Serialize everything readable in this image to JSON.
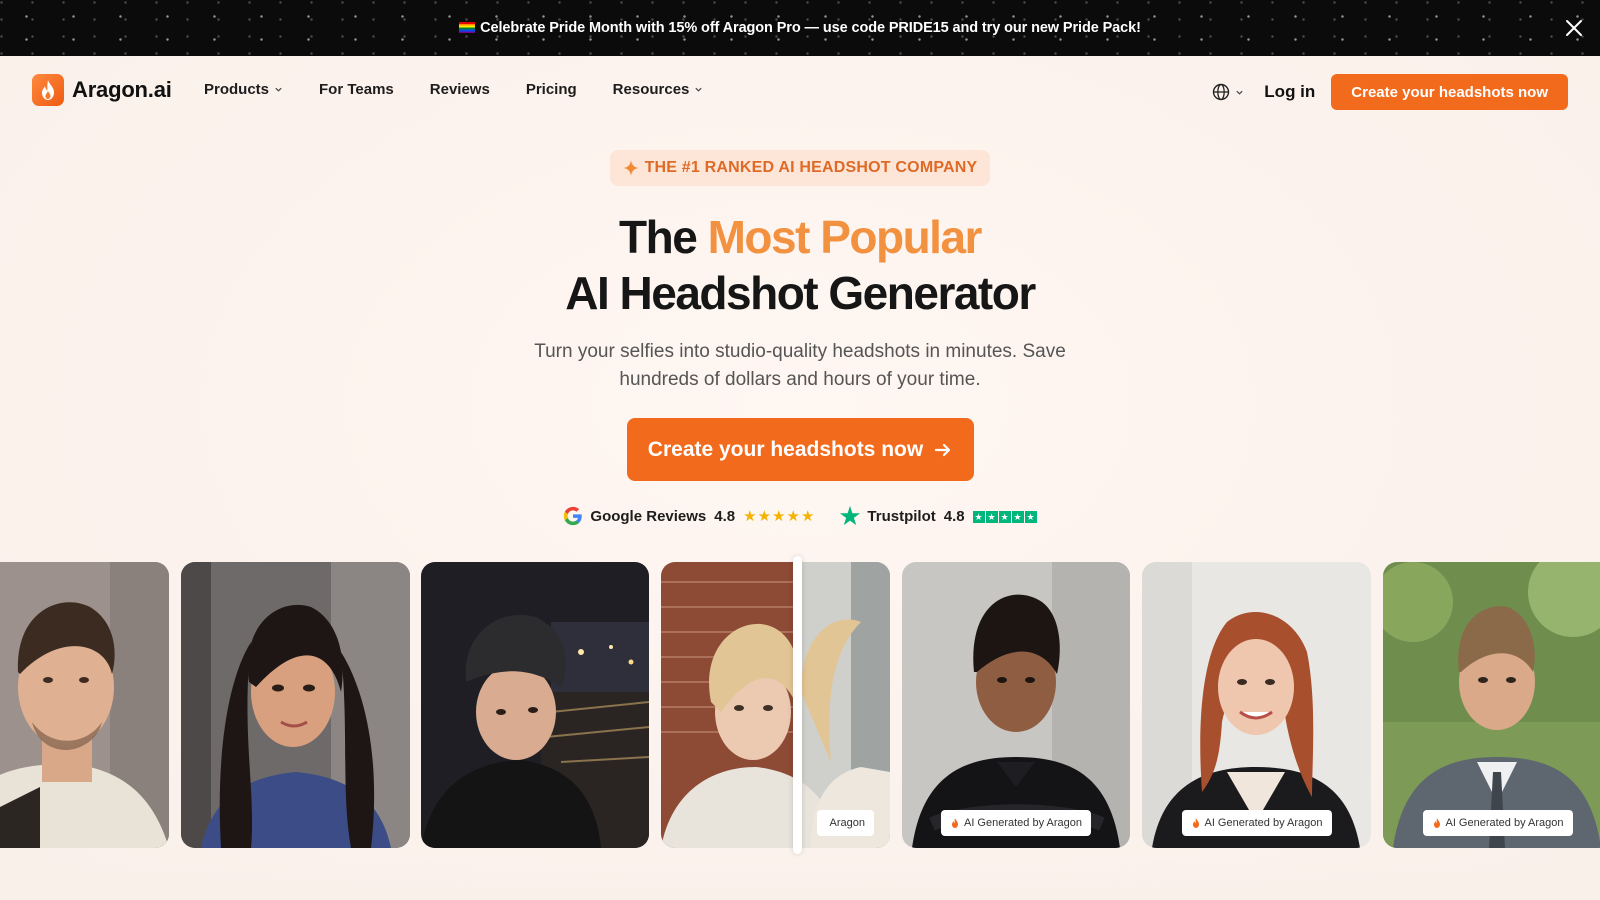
{
  "promo": {
    "text": "Celebrate Pride Month with 15% off Aragon Pro — use code  PRIDE15  and try our new Pride Pack!",
    "close_icon": "close-icon"
  },
  "nav": {
    "brand": "Aragon.ai",
    "links": [
      "Products",
      "For Teams",
      "Reviews",
      "Pricing",
      "Resources"
    ],
    "login": "Log in",
    "cta": "Create your headshots now"
  },
  "hero": {
    "badge": "THE #1 RANKED AI HEADSHOT COMPANY",
    "headline_pre": "The ",
    "headline_accent": "Most Popular",
    "headline_line2": "AI Headshot Generator",
    "subtitle": "Turn your selfies into studio-quality headshots in minutes. Save hundreds of dollars and hours of your time.",
    "cta": "Create your headshots now"
  },
  "ratings": {
    "google": {
      "name": "Google Reviews",
      "score": "4.8"
    },
    "trustpilot": {
      "name": "Trustpilot",
      "score": "4.8"
    }
  },
  "gallery": {
    "label_partial": "Aragon",
    "label": "AI Generated by Aragon"
  },
  "colors": {
    "accent": "#f26b1d",
    "accent_light": "#f29140",
    "badge_bg": "#fde6d8",
    "star_gold": "#f5b301",
    "trustpilot_green": "#00b67a"
  }
}
